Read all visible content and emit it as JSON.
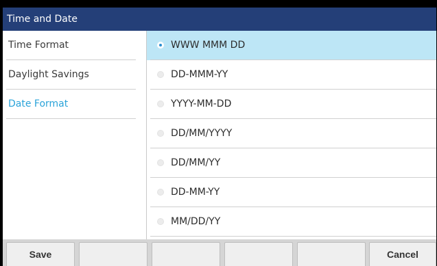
{
  "title": "Time and Date",
  "sidebar": {
    "items": [
      {
        "label": "Time Format"
      },
      {
        "label": "Daylight Savings"
      },
      {
        "label": "Date Format"
      }
    ]
  },
  "date_format_options": [
    {
      "label": "WWW MMM DD",
      "selected": true
    },
    {
      "label": "DD-MMM-YY",
      "selected": false
    },
    {
      "label": "YYYY-MM-DD",
      "selected": false
    },
    {
      "label": "DD/MM/YYYY",
      "selected": false
    },
    {
      "label": "DD/MM/YY",
      "selected": false
    },
    {
      "label": "DD-MM-YY",
      "selected": false
    },
    {
      "label": "MM/DD/YY",
      "selected": false
    }
  ],
  "softkeys": {
    "save_label": "Save",
    "key2_label": "",
    "key3_label": "",
    "key4_label": "",
    "key5_label": "",
    "cancel_label": "Cancel"
  },
  "colors": {
    "titlebar": "#243f78",
    "active_item": "#2aa3d9",
    "selected_row": "#bde6f6"
  }
}
